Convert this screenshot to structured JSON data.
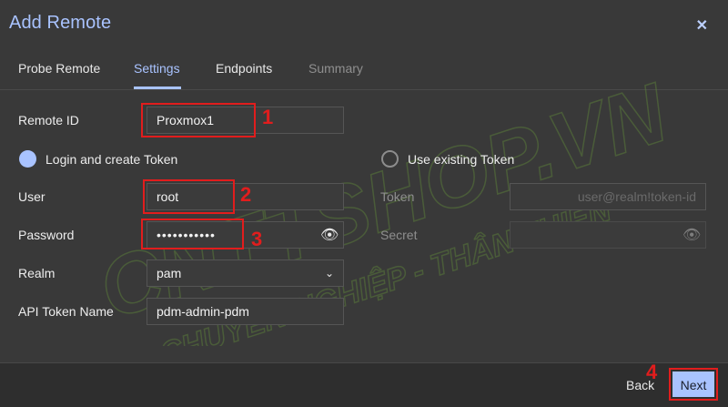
{
  "dialog": {
    "title": "Add Remote"
  },
  "tabs": [
    {
      "label": "Probe Remote"
    },
    {
      "label": "Settings"
    },
    {
      "label": "Endpoints"
    },
    {
      "label": "Summary"
    }
  ],
  "form": {
    "remote_id": {
      "label": "Remote ID",
      "value": "Proxmox1"
    },
    "login_option": {
      "label": "Login and create Token",
      "selected": true
    },
    "existing_token_option": {
      "label": "Use existing Token",
      "selected": false
    },
    "user": {
      "label": "User",
      "value": "root"
    },
    "password": {
      "label": "Password",
      "value": "•••••••••••"
    },
    "realm": {
      "label": "Realm",
      "value": "pam"
    },
    "api_token_name": {
      "label": "API Token Name",
      "value": "pdm-admin-pdm"
    },
    "token": {
      "label": "Token",
      "placeholder": "user@realm!token-id"
    },
    "secret": {
      "label": "Secret"
    }
  },
  "footer": {
    "back_label": "Back",
    "next_label": "Next"
  },
  "annotations": [
    "1",
    "2",
    "3",
    "4"
  ],
  "watermark": {
    "line1": "CNTTSHOP.VN",
    "line2": "CHUYÊN NGHIỆP - THÂN THIỆN"
  },
  "colors": {
    "accent": "#a9c3ff",
    "annotation": "#e11d1d",
    "background": "#393939"
  }
}
